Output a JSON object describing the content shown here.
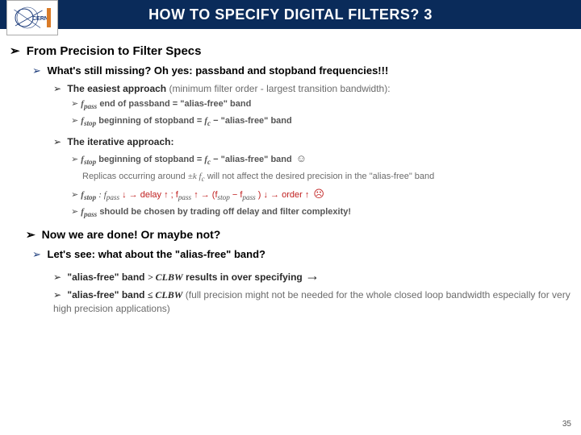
{
  "header": {
    "title": "HOW TO SPECIFY DIGITAL FILTERS? 3",
    "logo_text": "CERN"
  },
  "sec1": {
    "heading": "From Precision to Filter Specs"
  },
  "b1": {
    "text": "What's still missing? Oh yes: passband and stopband frequencies!!!"
  },
  "b2": {
    "lead": "The easiest approach",
    "tail": " (minimum filter order - largest transition bandwidth):",
    "s1a": "f",
    "s1b": "pass",
    "s1c": " end of passband = \"alias-free\" band",
    "s2a": "f",
    "s2b": "stop",
    "s2c": " beginning of stopband = ",
    "s2d": "f",
    "s2e": "c",
    "s2f": " − \"alias-free\" band"
  },
  "b3": {
    "lead": "The iterative approach:",
    "s1a": "f",
    "s1b": "stop",
    "s1c": " beginning of stopband = ",
    "s1d": "f",
    "s1e": "c",
    "s1f": " − \"alias-free\" band ",
    "note1": "Replicas occurring around ",
    "note2": "±k f",
    "note2b": "c",
    "note3": " will not affect the desired precision in the \"alias-free\" band",
    "s2a": "f",
    "s2b": "stop",
    "s2c": ": f",
    "s2d": "pass",
    "s2e": " ↓ → delay ↑ ;  f",
    "s2f": "pass",
    "s2g": " ↑ → (f",
    "s2h": "stop",
    "s2i": " − f",
    "s2j": "pass",
    "s2k": ") ↓ → order ↑ ",
    "s3a": "f",
    "s3b": "pass",
    "s3c": " should be chosen by trading off delay and filter complexity!"
  },
  "sec2": {
    "heading": "Now we are done! Or maybe not?"
  },
  "b4": {
    "text": "Let's see: what about the \"alias-free\" band?"
  },
  "b5": {
    "s1a": "\"alias-free\" band ",
    "s1b": "> CLBW",
    "s1c": " results in over specifying ",
    "s1arrow": "→",
    "s2a": "\"alias-free\" band ",
    "s2b": "≤ CLBW",
    "s2c": " (full precision might not be needed for the whole closed loop bandwidth especially for very high precision applications)"
  },
  "page": "35"
}
